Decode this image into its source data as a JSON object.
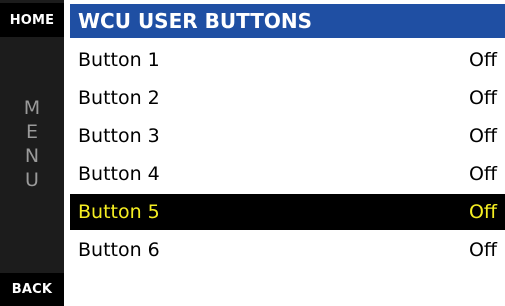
{
  "sidebar": {
    "home_label": "HOME",
    "menu_letters": [
      "M",
      "E",
      "N",
      "U"
    ],
    "back_label": "BACK"
  },
  "header": {
    "title": "WCU USER BUTTONS"
  },
  "list": {
    "items": [
      {
        "label": "Button 1",
        "value": "Off"
      },
      {
        "label": "Button 2",
        "value": "Off"
      },
      {
        "label": "Button 3",
        "value": "Off"
      },
      {
        "label": "Button 4",
        "value": "Off"
      },
      {
        "label": "Button 5",
        "value": "Off"
      },
      {
        "label": "Button 6",
        "value": "Off"
      }
    ],
    "selected_index": 4
  },
  "colors": {
    "header_bg": "#1f4fa3",
    "sidebar_bg": "#1c1c1c",
    "selected_bg": "#000000",
    "selected_text": "#f5ee22"
  }
}
